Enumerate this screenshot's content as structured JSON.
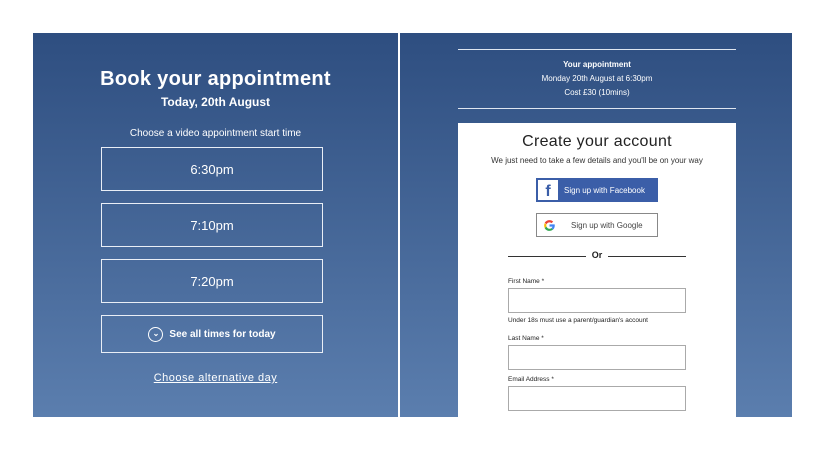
{
  "left": {
    "title": "Book your appointment",
    "date": "Today, 20th August",
    "choose_label": "Choose a video appointment start time",
    "slots": [
      "6:30pm",
      "7:10pm",
      "7:20pm"
    ],
    "see_all": "See all times for today",
    "alt_day": "Choose alternative day"
  },
  "right": {
    "appointment": {
      "heading": "Your appointment",
      "time": "Monday 20th August at 6:30pm",
      "cost": "Cost £30 (10mins)"
    },
    "account": {
      "title": "Create your account",
      "subtitle": "We just need to take a few details and you'll be on your way",
      "facebook_label": "Sign up with Facebook",
      "google_label": "Sign up with Google",
      "or_text": "Or",
      "first_name_label": "First Name *",
      "first_name_value": "",
      "first_name_note": "Under 18s must use a parent/guardian's account",
      "last_name_label": "Last Name *",
      "last_name_value": "",
      "email_label": "Email Address *",
      "email_value": ""
    }
  },
  "colors": {
    "panel_top": "#2e4e80",
    "panel_bottom": "#5b7eae",
    "facebook": "#3b5ea8"
  },
  "icons": [
    "chevron-down-icon",
    "facebook-icon",
    "google-icon"
  ]
}
